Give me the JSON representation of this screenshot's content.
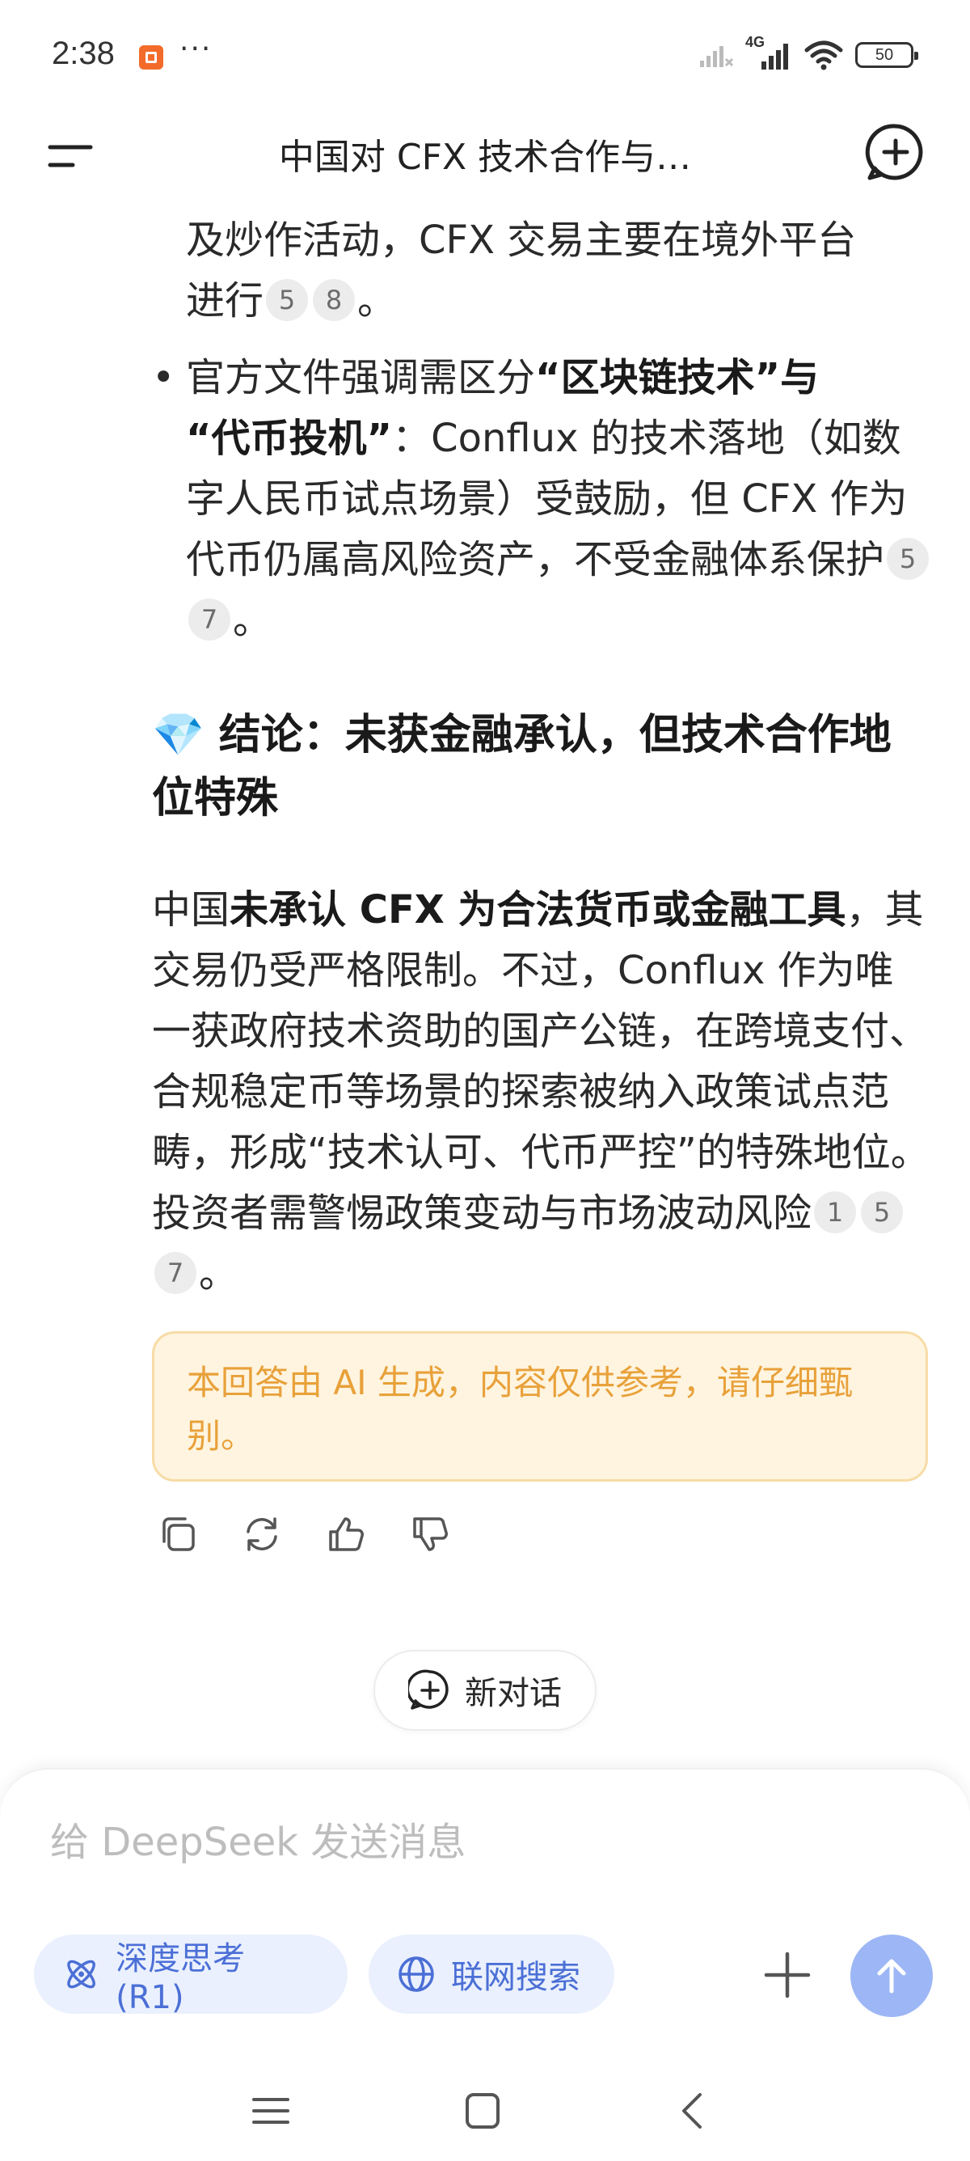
{
  "status_bar": {
    "time": "2:38",
    "dots": "···",
    "network": "4G",
    "battery": "50"
  },
  "header": {
    "title": "中国对 CFX 技术合作与…"
  },
  "content": {
    "bullet1_cont": {
      "line1": "及炒作活动，CFX 交易主要在境外平台",
      "line2": "进行",
      "cites": [
        "5",
        "8"
      ],
      "end": "。"
    },
    "bullet2": {
      "t1": "官方文件强调需区分",
      "b1": "“区块链技术”与",
      "b2": "“代币投机”",
      "t2": "：Conflux 的技术落地（如数字人民币试点场景）受鼓励，但 CFX 作为代币仍属高风险资产，不受金融体系保护",
      "cites": [
        "5",
        "7"
      ],
      "end": "。"
    },
    "conclusion": {
      "emoji": "💎",
      "heading": "结论：未获金融承认，但技术合作地位特殊"
    },
    "paragraph": {
      "t1": "中国",
      "b1": "未承认 CFX 为合法货币或金融工具",
      "t2": "，其交易仍受严格限制。不过，Conflux 作为唯一获政府技术资助的国产公链，在跨境支付、合规稳定币等场景的探索被纳入政策试点范畴，形成“技术认可、代币严控”的特殊地位。投资者需警惕政策变动与市场波动风险",
      "cites": [
        "1",
        "5",
        "7"
      ],
      "end": "。"
    },
    "disclaimer": "本回答由 AI 生成，内容仅供参考，请仔细甄别。"
  },
  "actions": [
    "copy-icon",
    "regenerate-icon",
    "thumbs-up-icon",
    "thumbs-down-icon"
  ],
  "new_dialog_label": "新对话",
  "input": {
    "placeholder": "给 DeepSeek 发送消息"
  },
  "chips": {
    "deep_think": "深度思考 (R1)",
    "web_search": "联网搜索"
  },
  "colors": {
    "accent": "#4b6fd6",
    "chip_bg": "#eaf0fd",
    "send_bg": "#9db6f5",
    "disclaimer_text": "#e8a13a",
    "disclaimer_bg": "#fff4df"
  }
}
